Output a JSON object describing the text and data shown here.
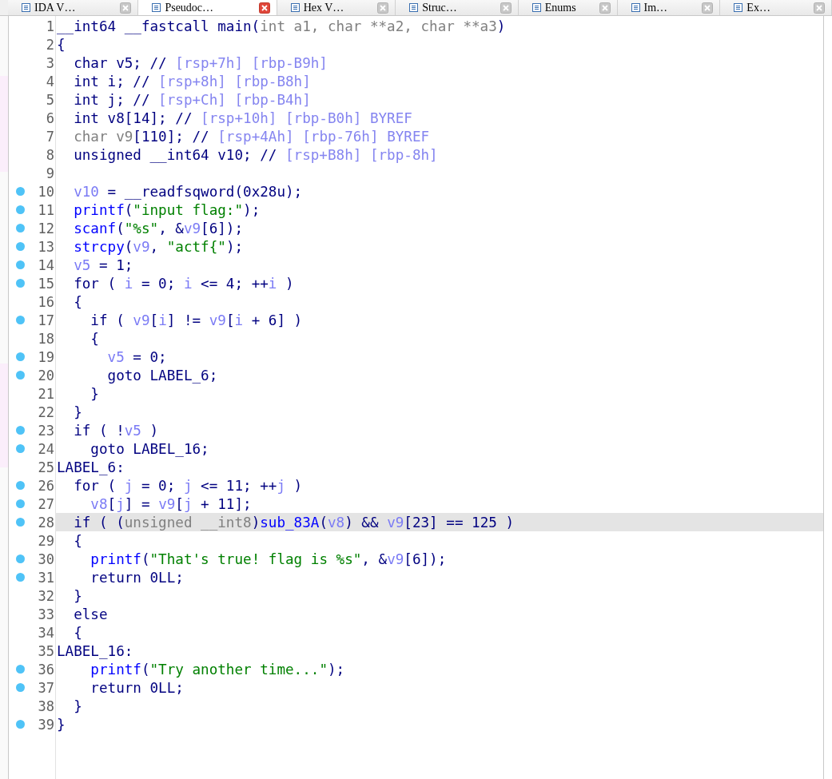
{
  "tabs": [
    {
      "label": "IDA V…",
      "selected": false
    },
    {
      "label": "Pseudoc…",
      "selected": true
    },
    {
      "label": "Hex V…",
      "selected": false
    },
    {
      "label": "Struc…",
      "selected": false
    },
    {
      "label": "Enums",
      "selected": false
    },
    {
      "label": "Im…",
      "selected": false
    },
    {
      "label": "Ex…",
      "selected": false
    }
  ],
  "lines": [
    {
      "number": "1",
      "dot": false,
      "selected": false,
      "segments": [
        {
          "kind": "code",
          "text": "__int64 __fastcall main("
        },
        {
          "kind": "dim",
          "text": "int a1, char **a2, char **a3"
        },
        {
          "kind": "code",
          "text": ")"
        }
      ]
    },
    {
      "number": "2",
      "dot": false,
      "selected": false,
      "segments": [
        {
          "kind": "code",
          "text": "{"
        }
      ]
    },
    {
      "number": "3",
      "dot": false,
      "selected": false,
      "segments": [
        {
          "kind": "code",
          "text": "  char v5; //"
        },
        {
          "kind": "comment",
          "text": " [rsp+7h] [rbp-B9h]"
        }
      ]
    },
    {
      "number": "4",
      "dot": false,
      "selected": false,
      "segments": [
        {
          "kind": "code",
          "text": "  int i; //"
        },
        {
          "kind": "comment",
          "text": " [rsp+8h] [rbp-B8h]"
        }
      ]
    },
    {
      "number": "5",
      "dot": false,
      "selected": false,
      "segments": [
        {
          "kind": "code",
          "text": "  int j; //"
        },
        {
          "kind": "comment",
          "text": " [rsp+Ch] [rbp-B4h]"
        }
      ]
    },
    {
      "number": "6",
      "dot": false,
      "selected": false,
      "segments": [
        {
          "kind": "code",
          "text": "  int v8[14]; //"
        },
        {
          "kind": "comment",
          "text": " [rsp+10h] [rbp-B0h] BYREF"
        }
      ]
    },
    {
      "number": "7",
      "dot": false,
      "selected": false,
      "segments": [
        {
          "kind": "dim",
          "text": "  char v9"
        },
        {
          "kind": "code",
          "text": "[110]; //"
        },
        {
          "kind": "comment",
          "text": " [rsp+4Ah] [rbp-76h] BYREF"
        }
      ]
    },
    {
      "number": "8",
      "dot": false,
      "selected": false,
      "segments": [
        {
          "kind": "code",
          "text": "  unsigned __int64 v10; //"
        },
        {
          "kind": "comment",
          "text": " [rsp+B8h] [rbp-8h]"
        }
      ]
    },
    {
      "number": "9",
      "dot": false,
      "selected": false
    },
    {
      "number": "10",
      "dot": true,
      "selected": false,
      "segments": [
        {
          "kind": "var",
          "text": "  v10"
        },
        {
          "kind": "code",
          "text": " = __readfsqword(0x28u);"
        }
      ]
    },
    {
      "number": "11",
      "dot": true,
      "selected": false,
      "segments": [
        {
          "kind": "fn",
          "text": "  printf"
        },
        {
          "kind": "code",
          "text": "("
        },
        {
          "kind": "str",
          "text": "\"input flag:\""
        },
        {
          "kind": "code",
          "text": ");"
        }
      ]
    },
    {
      "number": "12",
      "dot": true,
      "selected": false,
      "segments": [
        {
          "kind": "fn",
          "text": "  scanf"
        },
        {
          "kind": "code",
          "text": "("
        },
        {
          "kind": "str",
          "text": "\"%s\""
        },
        {
          "kind": "code",
          "text": ", &"
        },
        {
          "kind": "var",
          "text": "v9"
        },
        {
          "kind": "code",
          "text": "[6]);"
        }
      ]
    },
    {
      "number": "13",
      "dot": true,
      "selected": false,
      "segments": [
        {
          "kind": "fn",
          "text": "  strcpy"
        },
        {
          "kind": "code",
          "text": "("
        },
        {
          "kind": "var",
          "text": "v9"
        },
        {
          "kind": "code",
          "text": ", "
        },
        {
          "kind": "str",
          "text": "\"actf{\""
        },
        {
          "kind": "code",
          "text": ");"
        }
      ]
    },
    {
      "number": "14",
      "dot": true,
      "selected": false,
      "segments": [
        {
          "kind": "var",
          "text": "  v5"
        },
        {
          "kind": "code",
          "text": " = 1;"
        }
      ]
    },
    {
      "number": "15",
      "dot": true,
      "selected": false,
      "segments": [
        {
          "kind": "code",
          "text": "  for ( "
        },
        {
          "kind": "var",
          "text": "i"
        },
        {
          "kind": "code",
          "text": " = 0; "
        },
        {
          "kind": "var",
          "text": "i"
        },
        {
          "kind": "code",
          "text": " <= 4; ++"
        },
        {
          "kind": "var",
          "text": "i"
        },
        {
          "kind": "code",
          "text": " )"
        }
      ]
    },
    {
      "number": "16",
      "dot": false,
      "selected": false,
      "segments": [
        {
          "kind": "code",
          "text": "  {"
        }
      ]
    },
    {
      "number": "17",
      "dot": true,
      "selected": false,
      "segments": [
        {
          "kind": "code",
          "text": "    if ( "
        },
        {
          "kind": "var",
          "text": "v9"
        },
        {
          "kind": "code",
          "text": "["
        },
        {
          "kind": "var",
          "text": "i"
        },
        {
          "kind": "code",
          "text": "] != "
        },
        {
          "kind": "var",
          "text": "v9"
        },
        {
          "kind": "code",
          "text": "["
        },
        {
          "kind": "var",
          "text": "i"
        },
        {
          "kind": "code",
          "text": " + 6] )"
        }
      ]
    },
    {
      "number": "18",
      "dot": false,
      "selected": false,
      "segments": [
        {
          "kind": "code",
          "text": "    {"
        }
      ]
    },
    {
      "number": "19",
      "dot": true,
      "selected": false,
      "segments": [
        {
          "kind": "var",
          "text": "      v5"
        },
        {
          "kind": "code",
          "text": " = 0;"
        }
      ]
    },
    {
      "number": "20",
      "dot": true,
      "selected": false,
      "segments": [
        {
          "kind": "code",
          "text": "      goto LABEL_6;"
        }
      ]
    },
    {
      "number": "21",
      "dot": false,
      "selected": false,
      "segments": [
        {
          "kind": "code",
          "text": "    }"
        }
      ]
    },
    {
      "number": "22",
      "dot": false,
      "selected": false,
      "segments": [
        {
          "kind": "code",
          "text": "  }"
        }
      ]
    },
    {
      "number": "23",
      "dot": true,
      "selected": false,
      "segments": [
        {
          "kind": "code",
          "text": "  if ( !"
        },
        {
          "kind": "var",
          "text": "v5"
        },
        {
          "kind": "code",
          "text": " )"
        }
      ]
    },
    {
      "number": "24",
      "dot": true,
      "selected": false,
      "segments": [
        {
          "kind": "code",
          "text": "    goto LABEL_16;"
        }
      ]
    },
    {
      "number": "25",
      "dot": false,
      "selected": false,
      "segments": [
        {
          "kind": "code",
          "text": "LABEL_6:"
        }
      ]
    },
    {
      "number": "26",
      "dot": true,
      "selected": false,
      "segments": [
        {
          "kind": "code",
          "text": "  for ( "
        },
        {
          "kind": "var",
          "text": "j"
        },
        {
          "kind": "code",
          "text": " = 0; "
        },
        {
          "kind": "var",
          "text": "j"
        },
        {
          "kind": "code",
          "text": " <= 11; ++"
        },
        {
          "kind": "var",
          "text": "j"
        },
        {
          "kind": "code",
          "text": " )"
        }
      ]
    },
    {
      "number": "27",
      "dot": true,
      "selected": false,
      "segments": [
        {
          "kind": "var",
          "text": "    v8"
        },
        {
          "kind": "code",
          "text": "["
        },
        {
          "kind": "var",
          "text": "j"
        },
        {
          "kind": "code",
          "text": "] = "
        },
        {
          "kind": "var",
          "text": "v9"
        },
        {
          "kind": "code",
          "text": "["
        },
        {
          "kind": "var",
          "text": "j"
        },
        {
          "kind": "code",
          "text": " + 11];"
        }
      ]
    },
    {
      "number": "28",
      "dot": true,
      "selected": true,
      "segments": [
        {
          "kind": "code",
          "text": "  if ( ("
        },
        {
          "kind": "dim",
          "text": "unsigned __int8"
        },
        {
          "kind": "code",
          "text": ")"
        },
        {
          "kind": "fn",
          "text": "sub_83A"
        },
        {
          "kind": "code",
          "text": "("
        },
        {
          "kind": "var",
          "text": "v8"
        },
        {
          "kind": "code",
          "text": ") && "
        },
        {
          "kind": "var",
          "text": "v9"
        },
        {
          "kind": "code",
          "text": "[23] == 125 )"
        }
      ]
    },
    {
      "number": "29",
      "dot": false,
      "selected": false,
      "segments": [
        {
          "kind": "code",
          "text": "  {"
        }
      ]
    },
    {
      "number": "30",
      "dot": true,
      "selected": false,
      "segments": [
        {
          "kind": "fn",
          "text": "    printf"
        },
        {
          "kind": "code",
          "text": "("
        },
        {
          "kind": "str",
          "text": "\"That's true! flag is %s\""
        },
        {
          "kind": "code",
          "text": ", &"
        },
        {
          "kind": "var",
          "text": "v9"
        },
        {
          "kind": "code",
          "text": "[6]);"
        }
      ]
    },
    {
      "number": "31",
      "dot": true,
      "selected": false,
      "segments": [
        {
          "kind": "code",
          "text": "    return 0LL;"
        }
      ]
    },
    {
      "number": "32",
      "dot": false,
      "selected": false,
      "segments": [
        {
          "kind": "code",
          "text": "  }"
        }
      ]
    },
    {
      "number": "33",
      "dot": false,
      "selected": false,
      "segments": [
        {
          "kind": "code",
          "text": "  else"
        }
      ]
    },
    {
      "number": "34",
      "dot": false,
      "selected": false,
      "segments": [
        {
          "kind": "code",
          "text": "  {"
        }
      ]
    },
    {
      "number": "35",
      "dot": false,
      "selected": false,
      "segments": [
        {
          "kind": "code",
          "text": "LABEL_16:"
        }
      ]
    },
    {
      "number": "36",
      "dot": true,
      "selected": false,
      "segments": [
        {
          "kind": "fn",
          "text": "    printf"
        },
        {
          "kind": "code",
          "text": "("
        },
        {
          "kind": "str",
          "text": "\"Try another time...\""
        },
        {
          "kind": "code",
          "text": ");"
        }
      ]
    },
    {
      "number": "37",
      "dot": true,
      "selected": false,
      "segments": [
        {
          "kind": "code",
          "text": "    return 0LL;"
        }
      ]
    },
    {
      "number": "38",
      "dot": false,
      "selected": false,
      "segments": [
        {
          "kind": "code",
          "text": "  }"
        }
      ]
    },
    {
      "number": "39",
      "dot": true,
      "selected": false,
      "segments": [
        {
          "kind": "code",
          "text": "}"
        }
      ]
    }
  ]
}
